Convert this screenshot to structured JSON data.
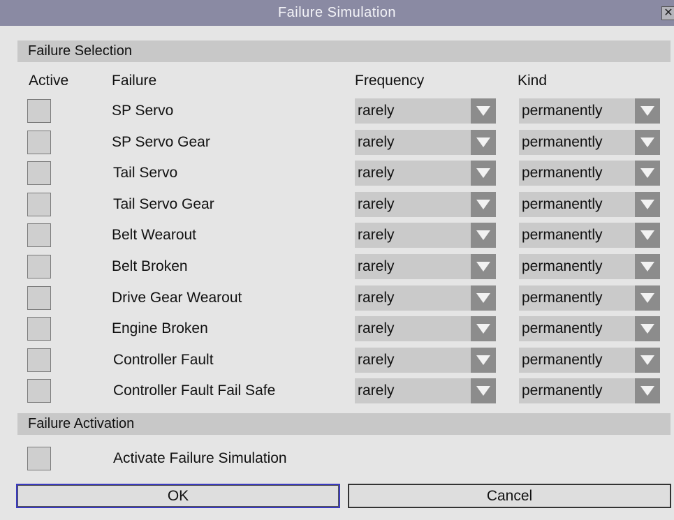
{
  "window": {
    "title": "Failure Simulation",
    "close_glyph": "✕"
  },
  "failure_selection": {
    "section_label": "Failure Selection",
    "headers": {
      "active": "Active",
      "failure": "Failure",
      "frequency": "Frequency",
      "kind": "Kind"
    },
    "rows": [
      {
        "name": "SP Servo",
        "active": false,
        "frequency": "rarely",
        "kind": "permanently"
      },
      {
        "name": "SP Servo Gear",
        "active": false,
        "frequency": "rarely",
        "kind": "permanently"
      },
      {
        "name": "Tail Servo",
        "active": false,
        "frequency": "rarely",
        "kind": "permanently"
      },
      {
        "name": "Tail Servo Gear",
        "active": false,
        "frequency": "rarely",
        "kind": "permanently"
      },
      {
        "name": "Belt Wearout",
        "active": false,
        "frequency": "rarely",
        "kind": "permanently"
      },
      {
        "name": "Belt Broken",
        "active": false,
        "frequency": "rarely",
        "kind": "permanently"
      },
      {
        "name": "Drive Gear Wearout",
        "active": false,
        "frequency": "rarely",
        "kind": "permanently"
      },
      {
        "name": "Engine Broken",
        "active": false,
        "frequency": "rarely",
        "kind": "permanently"
      },
      {
        "name": "Controller Fault",
        "active": false,
        "frequency": "rarely",
        "kind": "permanently"
      },
      {
        "name": "Controller Fault Fail Safe",
        "active": false,
        "frequency": "rarely",
        "kind": "permanently"
      }
    ]
  },
  "failure_activation": {
    "section_label": "Failure Activation",
    "activate_label": "Activate Failure Simulation",
    "active": false
  },
  "buttons": {
    "ok_label": "OK",
    "cancel_label": "Cancel"
  },
  "colors": {
    "titlebar": "#8a8aa3",
    "dialog_bg": "#e5e5e5",
    "section_bar": "#c8c8c8",
    "dropdown_bg": "#cacaca",
    "dropdown_arrow_bg": "#8c8c8c",
    "ok_focus_border": "#3a3ac0"
  },
  "icons": {
    "close": "close-icon",
    "dropdown": "triangle-down-icon"
  }
}
